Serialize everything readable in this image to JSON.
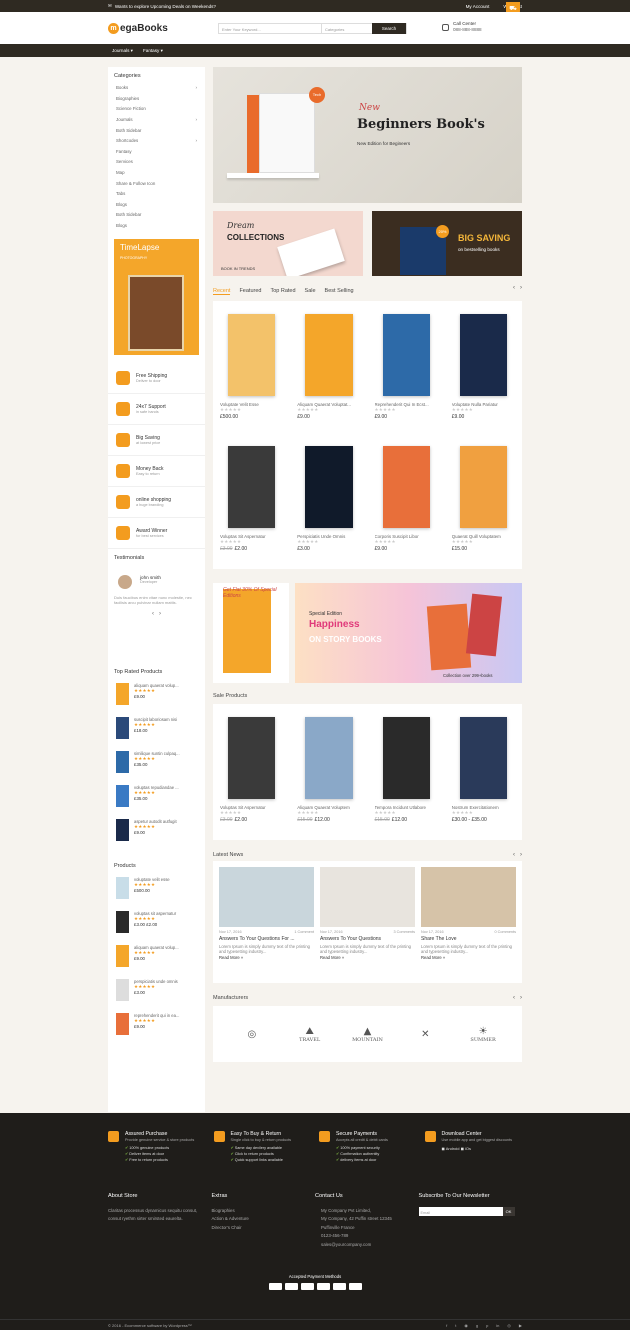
{
  "topbar": {
    "promo": "Wants to explore Upcoming Deals on Weekends?",
    "account": "My Account",
    "wishlist": "Wish List"
  },
  "header": {
    "logo": "egaBooks",
    "search_placeholder": "Enter Your Keyword...",
    "category": "Categories",
    "search_btn": "Search",
    "call_label": "Call Center",
    "call_number": "088-888-8888"
  },
  "nav": [
    "Journals",
    "Fantasy"
  ],
  "sidebar": {
    "categories_title": "Categories",
    "categories": [
      "Books",
      "Biographies",
      "Science Fiction",
      "Journals",
      "Both Sidebar",
      "Shortcodes",
      "Fantasy",
      "Services",
      "Map",
      "Share & Follow Icon",
      "Tabs",
      "Blogs",
      "Both Sidebar",
      "Blogs"
    ],
    "banner": {
      "title": "TimeLapse",
      "sub": "PHOTOGRAPHY"
    },
    "features": [
      {
        "t": "Free Shipping",
        "s": "Deliver to door"
      },
      {
        "t": "24x7 Support",
        "s": "in safe hands"
      },
      {
        "t": "Big Saving",
        "s": "at lowest price"
      },
      {
        "t": "Money Back",
        "s": "Easy to return"
      },
      {
        "t": "online shopping",
        "s": "a huge branding"
      },
      {
        "t": "Award Winner",
        "s": "for best services"
      }
    ],
    "testimonials_title": "Testimonials",
    "testimonial": {
      "name": "john smith",
      "role": "Developer",
      "text": "Duis faucibus enim vitae nunc molestie, nec facilisis arcu pulvinar nullam mattis."
    },
    "top_rated_title": "Top Rated Products",
    "top_rated": [
      {
        "n": "aliquam quaerat volup...",
        "p": "£9.00"
      },
      {
        "n": "suscipit laboriosam nisi",
        "p": "£18.00"
      },
      {
        "n": "similique suntin culpaq...",
        "p": "£35.00"
      },
      {
        "n": "voluptas repudiandae ...",
        "p": "£35.00"
      },
      {
        "n": "aspetur autodit autfugit",
        "p": "£9.00"
      }
    ],
    "products_title": "Products",
    "products": [
      {
        "n": "voluptate velit esse",
        "p": "£500.00",
        "old": ""
      },
      {
        "n": "voluptas sit aspernatur",
        "p": "£2.00",
        "old": "£3.00"
      },
      {
        "n": "aliquam quaerat volup...",
        "p": "£9.00",
        "old": ""
      },
      {
        "n": "perspiciatis unde omnis",
        "p": "£3.00",
        "old": ""
      },
      {
        "n": "reprehenderit qui in ea...",
        "p": "£9.00",
        "old": ""
      }
    ]
  },
  "hero": {
    "new": "New",
    "title": "Beginners Book's",
    "sub": "New Edition for Begineers",
    "badge": "Tech"
  },
  "duo": [
    {
      "t1": "Dream",
      "t2": "COLLECTIONS",
      "t3": "BOOK IN TRENDS"
    },
    {
      "pct": "20%",
      "t1": "BIG SAVING",
      "t2": "on bestselling books"
    }
  ],
  "tabs": [
    "Recent",
    "Featured",
    "Top Rated",
    "Sale",
    "Best Selling"
  ],
  "products": [
    {
      "n": "Voluptate Velit Esse",
      "p": "£500.00",
      "old": ""
    },
    {
      "n": "Aliquam Quaerat Voluptat...",
      "p": "£9.00",
      "old": ""
    },
    {
      "n": "Reprehenderit Qui In Ecst...",
      "p": "£9.00",
      "old": ""
    },
    {
      "n": "Voluptate Nulla Pariatur",
      "p": "£9.00",
      "old": ""
    },
    {
      "n": "Voluptas Sit Aspernatur",
      "p": "£2.00",
      "old": "£3.00"
    },
    {
      "n": "Perspiciatis Unde Omnis",
      "p": "£3.00",
      "old": ""
    },
    {
      "n": "Corporis Suscipit Libor",
      "p": "£9.00",
      "old": ""
    },
    {
      "n": "Quaerat Quill Voluptatem",
      "p": "£15.00",
      "old": ""
    }
  ],
  "promo": {
    "left": "Get Flat 30% Of Special Editions",
    "edition": "Special Edition",
    "title": "Happiness",
    "sub": "ON STORY BOOKS",
    "coll": "Collection over 299+books"
  },
  "sale_title": "Sale Products",
  "sale": [
    {
      "n": "Voluptas Sit Aspernatur",
      "p": "£2.00",
      "old": "£3.00"
    },
    {
      "n": "Aliquam Quaerat Voluptem",
      "p": "£12.00",
      "old": "£15.00"
    },
    {
      "n": "Tempora Incidunt Utlabore",
      "p": "£12.00",
      "old": "£15.00"
    },
    {
      "n": "Nostrum Exercitationem",
      "p": "£30.00 - £35.00",
      "old": ""
    }
  ],
  "news_title": "Latest News",
  "news": [
    {
      "d": "Nov 17, 2016",
      "c": "1 Comment",
      "t": "Answers To Your Questions For ...",
      "e": "Lorem Ipsum is simply dummy text of the printing and typesetting industry...",
      "r": "Read More »"
    },
    {
      "d": "Nov 17, 2016",
      "c": "3 Comments",
      "t": "Answers To Your Questions",
      "e": "Lorem Ipsum is simply dummy text of the printing and typesetting industry...",
      "r": "Read More »"
    },
    {
      "d": "Nov 17, 2016",
      "c": "0 Comments",
      "t": "Share The Love",
      "e": "Lorem Ipsum is simply dummy text of the printing and typesetting industry...",
      "r": "Read More »"
    }
  ],
  "manu_title": "Manufacturers",
  "manu": [
    "",
    "TRAVEL",
    "MOUNTAIN",
    "",
    "SUMMER"
  ],
  "services": [
    {
      "t": "Assured Purchase",
      "s": "Provide genuine service & store products",
      "li": [
        "100% genuine products",
        "Deliver items at door",
        "Free to return products"
      ]
    },
    {
      "t": "Easy To Buy & Return",
      "s": "Single click to buy & return products",
      "li": [
        "Same day devilery available",
        "Click to return products",
        "Quick support links available"
      ]
    },
    {
      "t": "Secure Payments",
      "s": "Accepts all credit & debit cards",
      "li": [
        "100% payment security",
        "Confirmation authentity",
        "delivery items at door"
      ]
    },
    {
      "t": "Download Center",
      "s": "Use mobile app and get biggest discounts",
      "li": []
    }
  ],
  "footer": {
    "about_title": "About Store",
    "about": "Claritas processus dynamicus sequitu consut, consut ryethm sirter smirsted eaurelta.",
    "extras_title": "Extras",
    "extras": [
      "Biographies",
      "Action & Adventure",
      "Director's Chair"
    ],
    "contact_title": "Contact Us",
    "contact": [
      "My Company Pvt Limited,",
      "My Company, 42 Puffin street 12345",
      "Puffinville France",
      "0123-456-789",
      "sales@yourcompany.com"
    ],
    "news_title": "Subscribe To Our Newsletter",
    "email": "Email",
    "ok": "OK",
    "pay": "Accepted Payment Methods",
    "copy": "© 2016 - Ecommerce software by Wordpress™"
  }
}
